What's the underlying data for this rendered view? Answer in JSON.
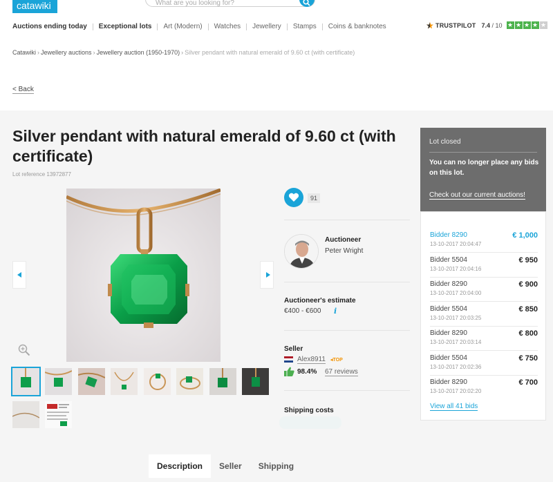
{
  "header": {
    "logo": "catawiki",
    "search_placeholder": "What are you looking for?"
  },
  "nav": {
    "items": [
      {
        "label": "Auctions ending today",
        "bold": true
      },
      {
        "label": "Exceptional lots",
        "bold": true
      },
      {
        "label": "Art (Modern)",
        "bold": false
      },
      {
        "label": "Watches",
        "bold": false
      },
      {
        "label": "Jewellery",
        "bold": false
      },
      {
        "label": "Stamps",
        "bold": false
      },
      {
        "label": "Coins & banknotes",
        "bold": false
      }
    ]
  },
  "trustpilot": {
    "name": "TRUSTPILOT",
    "score": "7.4",
    "out_of": "/ 10",
    "stars_filled": 4,
    "stars_total": 5
  },
  "breadcrumb": {
    "items": [
      "Catawiki",
      "Jewellery auctions",
      "Jewellery auction (1950-1970)"
    ],
    "separator": "›",
    "current": "Silver pendant with natural emerald of 9.60 ct (with certificate)"
  },
  "back_label": "< Back",
  "lot": {
    "title": "Silver pendant with natural emerald of 9.60 ct (with certificate)",
    "reference": "Lot reference 13972877"
  },
  "favorites": {
    "count": "91"
  },
  "auctioneer": {
    "label": "Auctioneer",
    "name": "Peter Wright"
  },
  "estimate": {
    "label": "Auctioneer's estimate",
    "value": "€400 - €600",
    "info": "i"
  },
  "seller": {
    "label": "Seller",
    "name": "Alex8911",
    "badge": "◂TOP",
    "rating": "98.4%",
    "reviews": "67 reviews"
  },
  "shipping": {
    "label": "Shipping costs"
  },
  "status": {
    "title": "Lot closed",
    "message": "You can no longer place any bids on this lot.",
    "link": "Check out our current auctions!"
  },
  "bids": [
    {
      "bidder": "Bidder 8290",
      "date": "13-10-2017 20:04:47",
      "amount": "€ 1,000"
    },
    {
      "bidder": "Bidder 5504",
      "date": "13-10-2017 20:04:16",
      "amount": "€ 950"
    },
    {
      "bidder": "Bidder 8290",
      "date": "13-10-2017 20:04:00",
      "amount": "€ 900"
    },
    {
      "bidder": "Bidder 5504",
      "date": "13-10-2017 20:03:25",
      "amount": "€ 850"
    },
    {
      "bidder": "Bidder 8290",
      "date": "13-10-2017 20:03:14",
      "amount": "€ 800"
    },
    {
      "bidder": "Bidder 5504",
      "date": "13-10-2017 20:02:36",
      "amount": "€ 750"
    },
    {
      "bidder": "Bidder 8290",
      "date": "13-10-2017 20:02:20",
      "amount": "€ 700"
    }
  ],
  "view_all_bids": "View all 41 bids",
  "tabs": [
    {
      "label": "Description",
      "active": true
    },
    {
      "label": "Seller",
      "active": false
    },
    {
      "label": "Shipping",
      "active": false
    }
  ],
  "colors": {
    "accent": "#1aa4d8",
    "status_panel": "#6d6d6d",
    "trustpilot_green": "#4db34d",
    "top_badge": "#f39200"
  },
  "icons": [
    "search-icon",
    "heart-icon",
    "info-icon",
    "zoom-icon",
    "thumbs-up-icon",
    "flag-icon",
    "arrow-left-icon",
    "arrow-right-icon",
    "trustpilot-logo-icon"
  ]
}
